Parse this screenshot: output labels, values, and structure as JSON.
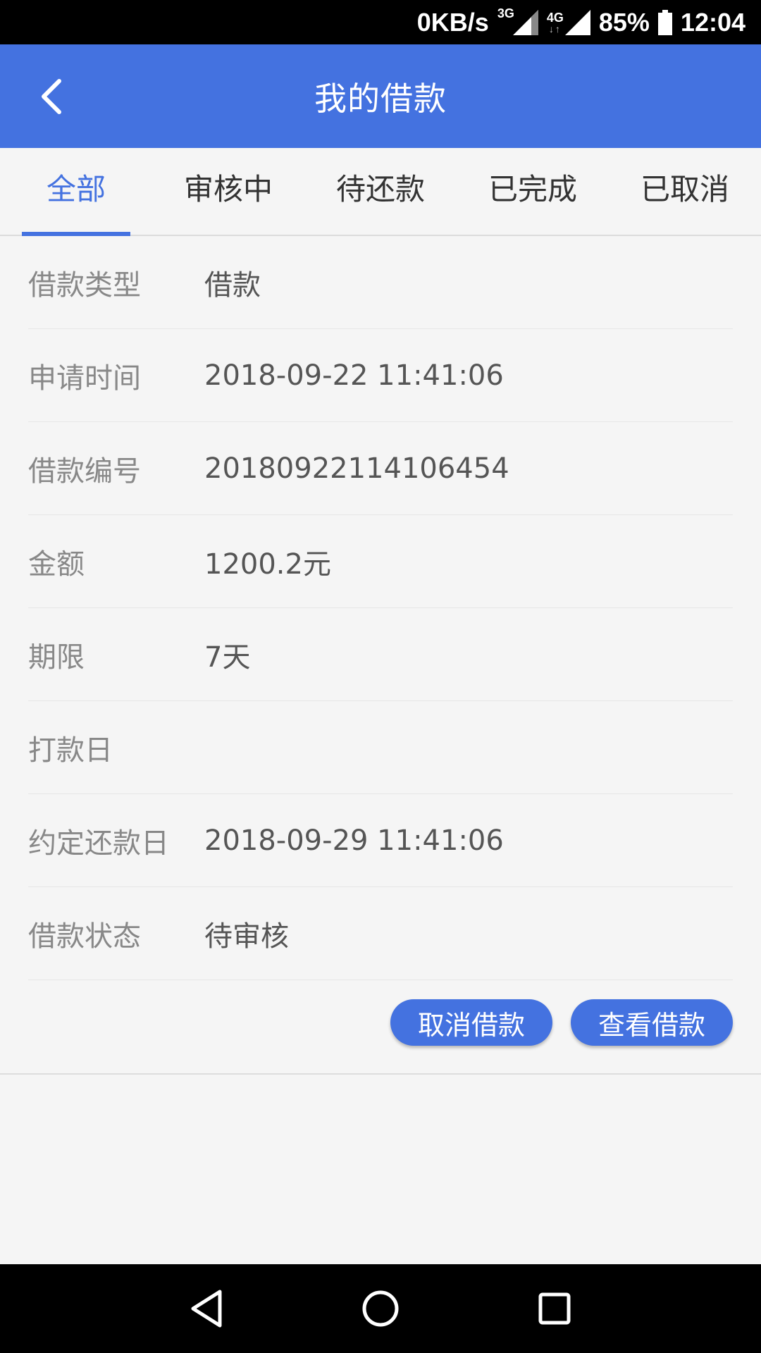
{
  "status_bar": {
    "speed": "0KB/s",
    "net1": "3G",
    "net2": "4G",
    "battery": "85%",
    "time": "12:04"
  },
  "header": {
    "title": "我的借款",
    "back_icon": "chevron-left-icon"
  },
  "tabs": [
    {
      "label": "全部",
      "active": true
    },
    {
      "label": "审核中",
      "active": false
    },
    {
      "label": "待还款",
      "active": false
    },
    {
      "label": "已完成",
      "active": false
    },
    {
      "label": "已取消",
      "active": false
    }
  ],
  "loan": {
    "rows": [
      {
        "label": "借款类型",
        "value": "借款"
      },
      {
        "label": "申请时间",
        "value": "2018-09-22 11:41:06"
      },
      {
        "label": "借款编号",
        "value": "20180922114106454"
      },
      {
        "label": "金额",
        "value": "1200.2元"
      },
      {
        "label": "期限",
        "value": "7天"
      },
      {
        "label": "打款日",
        "value": ""
      },
      {
        "label": "约定还款日",
        "value": "2018-09-29 11:41:06"
      },
      {
        "label": "借款状态",
        "value": "待审核"
      }
    ],
    "cancel_button": "取消借款",
    "view_button": "查看借款"
  },
  "colors": {
    "primary": "#4472e0",
    "background": "#f5f5f5"
  }
}
